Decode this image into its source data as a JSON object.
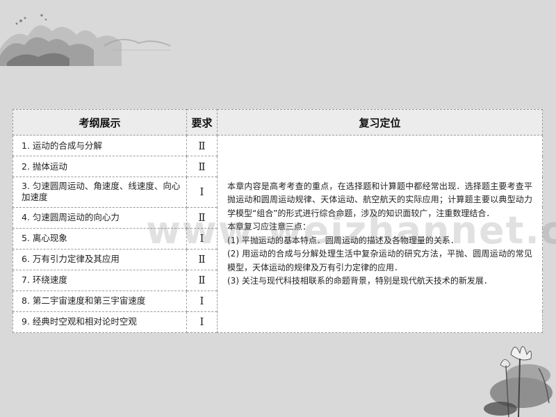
{
  "table": {
    "headers": [
      "考纲展示",
      "要求",
      "复习定位"
    ],
    "rows": [
      {
        "topic": "1. 运动的合成与分解",
        "req": "Ⅱ"
      },
      {
        "topic": "2. 抛体运动",
        "req": "Ⅱ"
      },
      {
        "topic": "3. 匀速圆周运动、角速度、线速度、向心加速度",
        "req": "Ⅰ"
      },
      {
        "topic": "4. 匀速圆周运动的向心力",
        "req": "Ⅱ"
      },
      {
        "topic": "5. 离心现象",
        "req": "Ⅰ"
      },
      {
        "topic": "6. 万有引力定律及其应用",
        "req": "Ⅱ"
      },
      {
        "topic": "7. 环绕速度",
        "req": "Ⅱ"
      },
      {
        "topic": "8. 第二宇宙速度和第三宇宙速度",
        "req": "Ⅰ"
      },
      {
        "topic": "9. 经典时空观和相对论时空观",
        "req": "Ⅰ"
      }
    ],
    "review": [
      "本章内容是高考考查的重点，在选择题和计算题中都经常出现．选择题主要考查平抛运动和圆周运动规律、天体运动、航空航天的实际应用；计算题主要以典型动力学模型“组合”的形式进行综合命题，涉及的知识面较广，注重数理结合．",
      "本章复习应注意三点：",
      "(1) 平抛运动的基本特点．圆周运动的描述及各物理量的关系．",
      "(2) 用运动的合成与分解处理生活中复杂运动的研究方法，平抛、圆周运动的常见模型，天体运动的规律及万有引力定律的应用．",
      "(3) 关注与现代科技相联系的命题背景，特别是现代航天技术的新发展．"
    ]
  },
  "watermark": "www.weizhannet.com",
  "decorations": {
    "top_left": "ink-mountain-landscape",
    "bottom_right": "ink-lotus-painting"
  }
}
